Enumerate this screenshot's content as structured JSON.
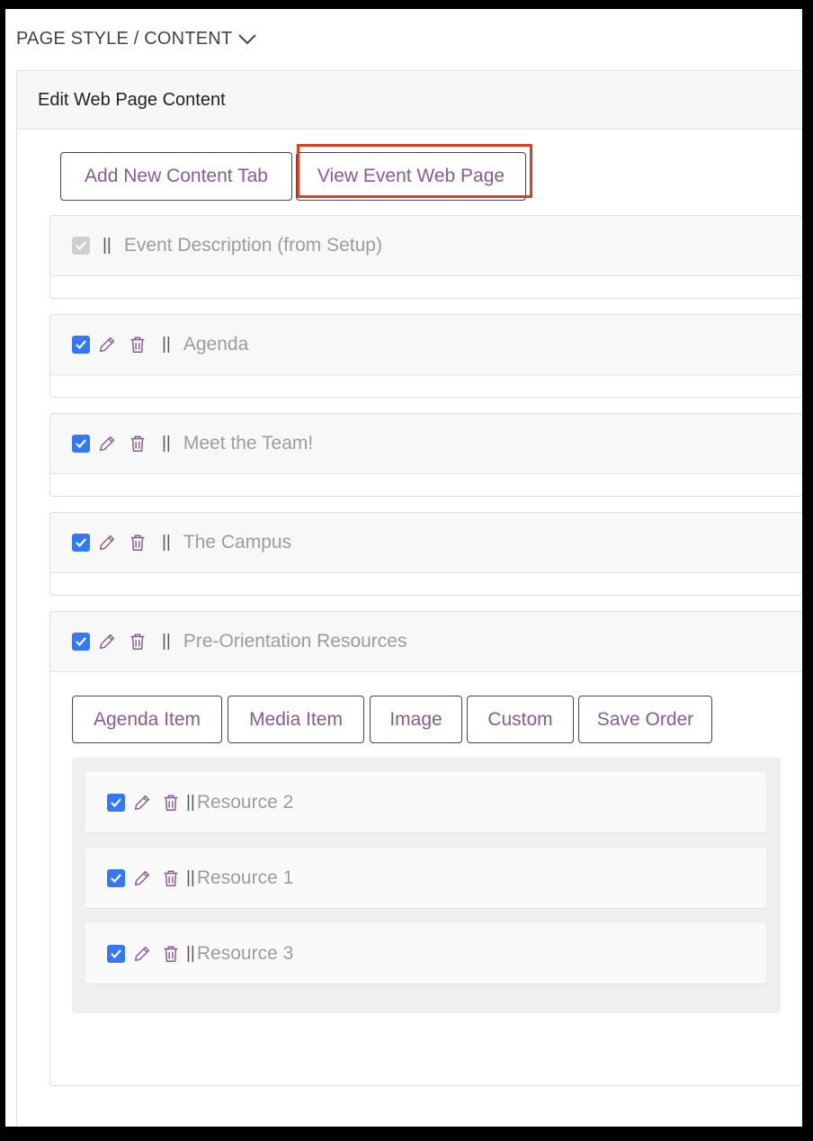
{
  "section": {
    "title": "PAGE STYLE / CONTENT"
  },
  "panel": {
    "title": "Edit Web Page Content"
  },
  "toolbar": {
    "add_tab": "Add New Content Tab",
    "view_page": "View Event Web Page"
  },
  "tabs": [
    {
      "title": "Event Description (from Setup)",
      "checked": true,
      "locked": true
    },
    {
      "title": "Agenda",
      "checked": true
    },
    {
      "title": "Meet the Team!",
      "checked": true
    },
    {
      "title": "The Campus",
      "checked": true
    },
    {
      "title": "Pre-Orientation Resources",
      "checked": true,
      "expanded": true
    }
  ],
  "tab_actions": {
    "agenda_item": "Agenda Item",
    "media_item": "Media Item",
    "image": "Image",
    "custom": "Custom",
    "save_order": "Save Order"
  },
  "resources": [
    {
      "title": "Resource 2",
      "checked": true
    },
    {
      "title": "Resource 1",
      "checked": true
    },
    {
      "title": "Resource 3",
      "checked": true
    }
  ],
  "grip_glyph": "||",
  "colors": {
    "accent": "#8a5a93",
    "checkbox": "#3478f6",
    "highlight": "#e23b26"
  },
  "icons": [
    "chevron-down-icon",
    "pencil-icon",
    "trash-icon",
    "checkbox-icon",
    "drag-handle-icon"
  ]
}
